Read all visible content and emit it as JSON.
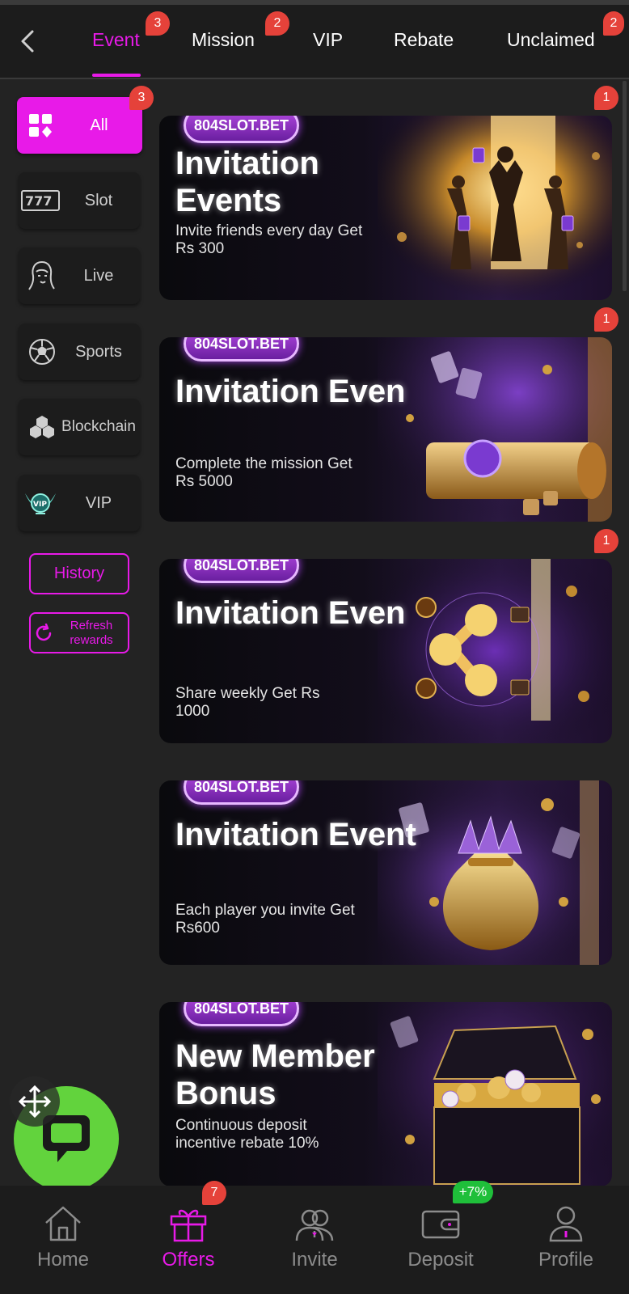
{
  "colors": {
    "accent": "#e81ae8",
    "badge": "#e5423a",
    "chat": "#62d33d",
    "background": "#232323"
  },
  "header": {
    "tabs": [
      {
        "label": "Event",
        "badge": "3",
        "active": true
      },
      {
        "label": "Mission",
        "badge": "2"
      },
      {
        "label": "VIP"
      },
      {
        "label": "Rebate"
      },
      {
        "label": "Unclaimed",
        "badge": "2"
      }
    ]
  },
  "sidebar": {
    "items": [
      {
        "label": "All",
        "icon": "grid-icon",
        "badge": "3",
        "active": true
      },
      {
        "label": "Slot",
        "icon": "slot-777-icon"
      },
      {
        "label": "Live",
        "icon": "dealer-icon"
      },
      {
        "label": "Sports",
        "icon": "soccer-ball-icon"
      },
      {
        "label": "Blockchain",
        "icon": "blockchain-icon"
      },
      {
        "label": "VIP",
        "icon": "vip-wings-icon"
      }
    ],
    "history_label": "History",
    "refresh_label": "Refresh rewards"
  },
  "banners": [
    {
      "brand": "804SLOT.BET",
      "title": "Invitation Events",
      "desc": "Invite friends every day Get Rs 300",
      "badge": "1"
    },
    {
      "brand": "804SLOT.BET",
      "title": "Invitation Even",
      "desc": "Complete the mission Get Rs 5000",
      "badge": "1"
    },
    {
      "brand": "804SLOT.BET",
      "title": "Invitation Even",
      "desc": "Share weekly Get Rs 1000",
      "badge": "1"
    },
    {
      "brand": "804SLOT.BET",
      "title": "Invitation Event",
      "desc": "Each player you invite Get Rs600"
    },
    {
      "brand": "804SLOT.BET",
      "title": "New Member Bonus",
      "desc": "Continuous deposit incentive rebate 10%"
    }
  ],
  "bottom_nav": [
    {
      "label": "Home",
      "icon": "home-icon"
    },
    {
      "label": "Offers",
      "icon": "gift-icon",
      "badge": "7",
      "active": true
    },
    {
      "label": "Invite",
      "icon": "users-icon"
    },
    {
      "label": "Deposit",
      "icon": "wallet-icon",
      "badge": "+7%"
    },
    {
      "label": "Profile",
      "icon": "user-icon"
    }
  ]
}
